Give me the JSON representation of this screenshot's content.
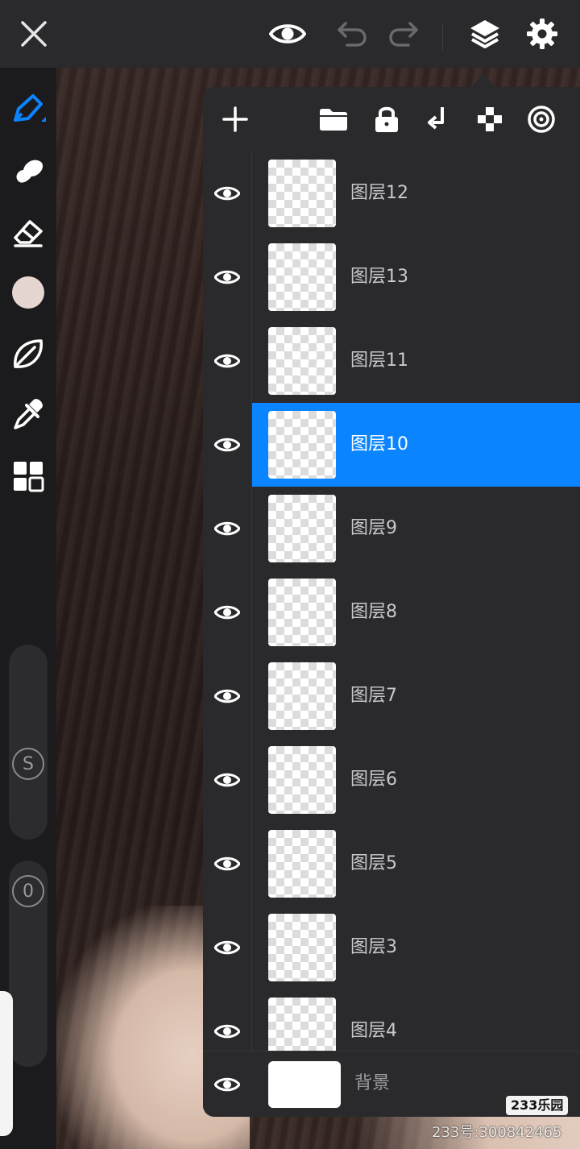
{
  "app": {
    "accent_color": "#0a84ff",
    "panel_color": "#2a2a2c"
  },
  "top_bar": {
    "icons": [
      "close-icon",
      "eye-icon",
      "undo-icon",
      "redo-icon",
      "layers-icon",
      "gear-icon"
    ]
  },
  "left_toolbar": {
    "tools": [
      "pen-icon",
      "smudge-icon",
      "eraser-icon",
      "color-swatch",
      "leaf-icon",
      "eyedropper-icon",
      "grid-icon"
    ],
    "brush_color": "#e6d6d2",
    "size_slider_label": "S",
    "opacity_slider_label": "0"
  },
  "layers_panel": {
    "toolbar_icons": [
      "plus-icon",
      "folder-icon",
      "lock-icon",
      "merge-down-icon",
      "checker-icon",
      "ring-icon"
    ],
    "layers": [
      {
        "name": "图层12",
        "selected": false
      },
      {
        "name": "图层13",
        "selected": false
      },
      {
        "name": "图层11",
        "selected": false
      },
      {
        "name": "图层10",
        "selected": true
      },
      {
        "name": "图层9",
        "selected": false
      },
      {
        "name": "图层8",
        "selected": false
      },
      {
        "name": "图层7",
        "selected": false
      },
      {
        "name": "图层6",
        "selected": false
      },
      {
        "name": "图层5",
        "selected": false
      },
      {
        "name": "图层3",
        "selected": false
      },
      {
        "name": "图层4",
        "selected": false
      }
    ],
    "background_layer": {
      "name": "背景"
    }
  },
  "watermark": {
    "logo": "233乐园",
    "id_text": "233号:300842465"
  }
}
